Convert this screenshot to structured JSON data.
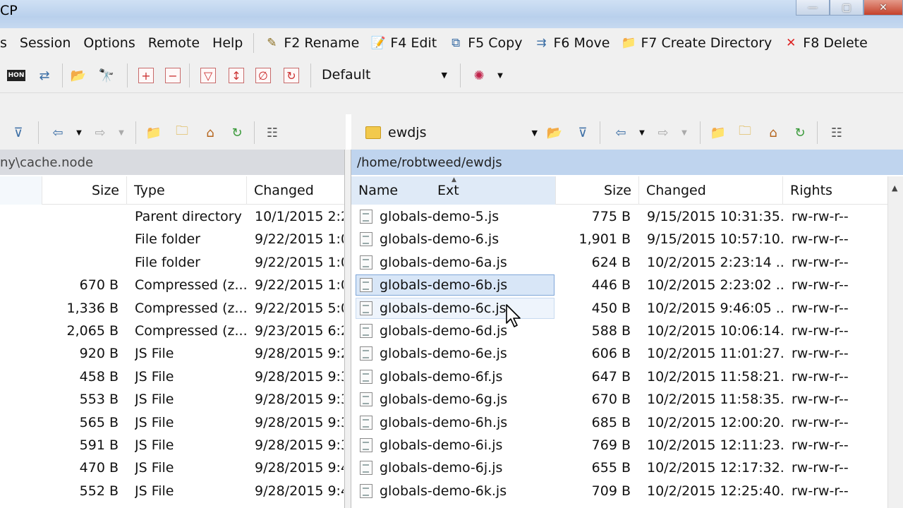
{
  "title": {
    "app": "CP"
  },
  "menu": {
    "items": [
      "s",
      "Session",
      "Options",
      "Remote",
      "Help"
    ],
    "commands": [
      {
        "label": "F2 Rename",
        "icon": "rename-icon"
      },
      {
        "label": "F4 Edit",
        "icon": "edit-icon"
      },
      {
        "label": "F5 Copy",
        "icon": "copy-icon"
      },
      {
        "label": "F6 Move",
        "icon": "move-icon"
      },
      {
        "label": "F7 Create Directory",
        "icon": "create-directory-icon"
      },
      {
        "label": "F8 Delete",
        "icon": "delete-icon"
      }
    ]
  },
  "toolbar": {
    "session_select": "Default",
    "hon_label": "HON"
  },
  "right_panel": {
    "dir_select": "ewdjs",
    "path": "/home/robtweed/ewdjs",
    "headers": {
      "name": "Name",
      "ext": "Ext",
      "size": "Size",
      "changed": "Changed",
      "rights": "Rights"
    },
    "rows": [
      {
        "name": "globals-demo-5.js",
        "size": "775 B",
        "changed": "9/15/2015 10:31:35...",
        "rights": "rw-rw-r--"
      },
      {
        "name": "globals-demo-6.js",
        "size": "1,901 B",
        "changed": "9/15/2015 10:57:10...",
        "rights": "rw-rw-r--"
      },
      {
        "name": "globals-demo-6a.js",
        "size": "624 B",
        "changed": "10/2/2015 2:23:14 ...",
        "rights": "rw-rw-r--"
      },
      {
        "name": "globals-demo-6b.js",
        "size": "446 B",
        "changed": "10/2/2015 2:23:02 ...",
        "rights": "rw-rw-r--"
      },
      {
        "name": "globals-demo-6c.js",
        "size": "450 B",
        "changed": "10/2/2015 9:46:05 ...",
        "rights": "rw-rw-r--"
      },
      {
        "name": "globals-demo-6d.js",
        "size": "588 B",
        "changed": "10/2/2015 10:06:14...",
        "rights": "rw-rw-r--"
      },
      {
        "name": "globals-demo-6e.js",
        "size": "606 B",
        "changed": "10/2/2015 11:01:27...",
        "rights": "rw-rw-r--"
      },
      {
        "name": "globals-demo-6f.js",
        "size": "647 B",
        "changed": "10/2/2015 11:58:21...",
        "rights": "rw-rw-r--"
      },
      {
        "name": "globals-demo-6g.js",
        "size": "670 B",
        "changed": "10/2/2015 11:58:35...",
        "rights": "rw-rw-r--"
      },
      {
        "name": "globals-demo-6h.js",
        "size": "685 B",
        "changed": "10/2/2015 12:00:20...",
        "rights": "rw-rw-r--"
      },
      {
        "name": "globals-demo-6i.js",
        "size": "769 B",
        "changed": "10/2/2015 12:11:23...",
        "rights": "rw-rw-r--"
      },
      {
        "name": "globals-demo-6j.js",
        "size": "655 B",
        "changed": "10/2/2015 12:17:32...",
        "rights": "rw-rw-r--"
      },
      {
        "name": "globals-demo-6k.js",
        "size": "709 B",
        "changed": "10/2/2015 12:25:40...",
        "rights": "rw-rw-r--"
      }
    ]
  },
  "left_panel": {
    "path": "ny\\cache.node",
    "headers": {
      "size": "Size",
      "type": "Type",
      "changed": "Changed"
    },
    "rows": [
      {
        "size": "",
        "type": "Parent directory",
        "changed": "10/1/2015 2:2"
      },
      {
        "size": "",
        "type": "File folder",
        "changed": "9/22/2015 1:0"
      },
      {
        "size": "",
        "type": "File folder",
        "changed": "9/22/2015 1:0"
      },
      {
        "size": "670 B",
        "type": "Compressed (z...",
        "changed": "9/22/2015 1:0"
      },
      {
        "size": "1,336 B",
        "type": "Compressed (z...",
        "changed": "9/22/2015 5:0"
      },
      {
        "size": "2,065 B",
        "type": "Compressed (z...",
        "changed": "9/23/2015 6:2"
      },
      {
        "size": "920 B",
        "type": "JS File",
        "changed": "9/28/2015 9:2"
      },
      {
        "size": "458 B",
        "type": "JS File",
        "changed": "9/28/2015 9:3"
      },
      {
        "size": "553 B",
        "type": "JS File",
        "changed": "9/28/2015 9:3"
      },
      {
        "size": "565 B",
        "type": "JS File",
        "changed": "9/28/2015 9:3"
      },
      {
        "size": "591 B",
        "type": "JS File",
        "changed": "9/28/2015 9:3"
      },
      {
        "size": "470 B",
        "type": "JS File",
        "changed": "9/28/2015 9:4"
      },
      {
        "size": "552 B",
        "type": "JS File",
        "changed": "9/28/2015 9:4"
      }
    ]
  },
  "selection": {
    "selected_row": 3,
    "hover_row": 4
  }
}
